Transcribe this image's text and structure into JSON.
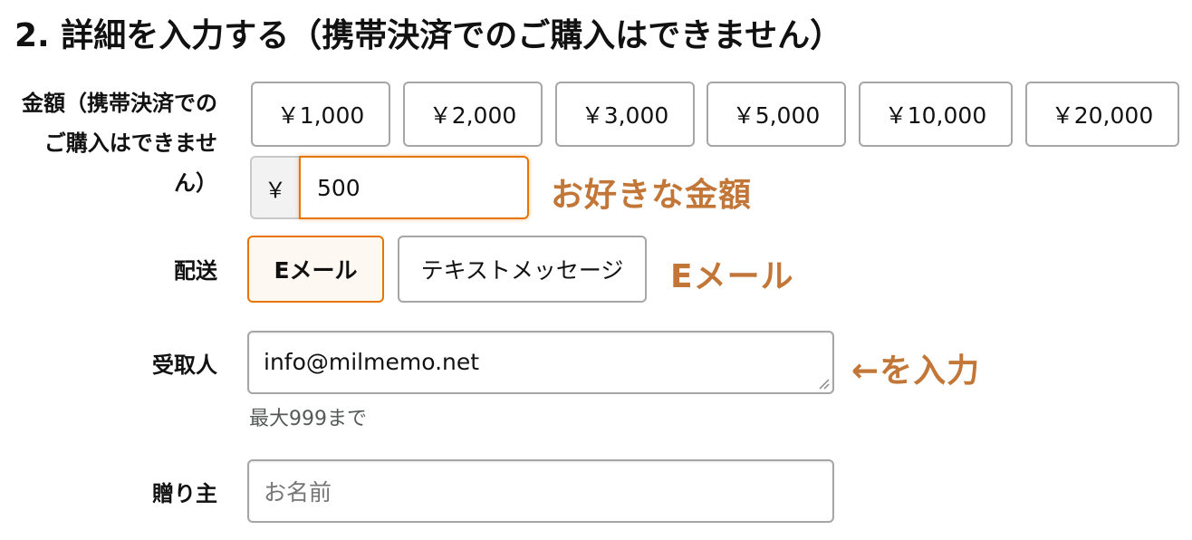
{
  "section": {
    "title": "2. 詳細を入力する（携帯決済でのご購入はできません）"
  },
  "amount": {
    "label": "金額（携帯決済でのご購入はできません）",
    "options": [
      "￥1,000",
      "￥2,000",
      "￥3,000",
      "￥5,000",
      "￥10,000",
      "￥20,000"
    ],
    "currency_prefix": "￥",
    "custom_value": "500",
    "annotation": "お好きな金額"
  },
  "delivery": {
    "label": "配送",
    "options": [
      "Eメール",
      "テキストメッセージ"
    ],
    "selected": "Eメール",
    "annotation": "Eメール"
  },
  "recipient": {
    "label": "受取人",
    "value": "info@milmemo.net",
    "hint": "最大999まで",
    "annotation": "←を入力"
  },
  "sender": {
    "label": "贈り主",
    "placeholder": "お名前"
  },
  "colors": {
    "accent": "#e77600",
    "annotation": "#c27738",
    "border": "#a6a6a6"
  }
}
